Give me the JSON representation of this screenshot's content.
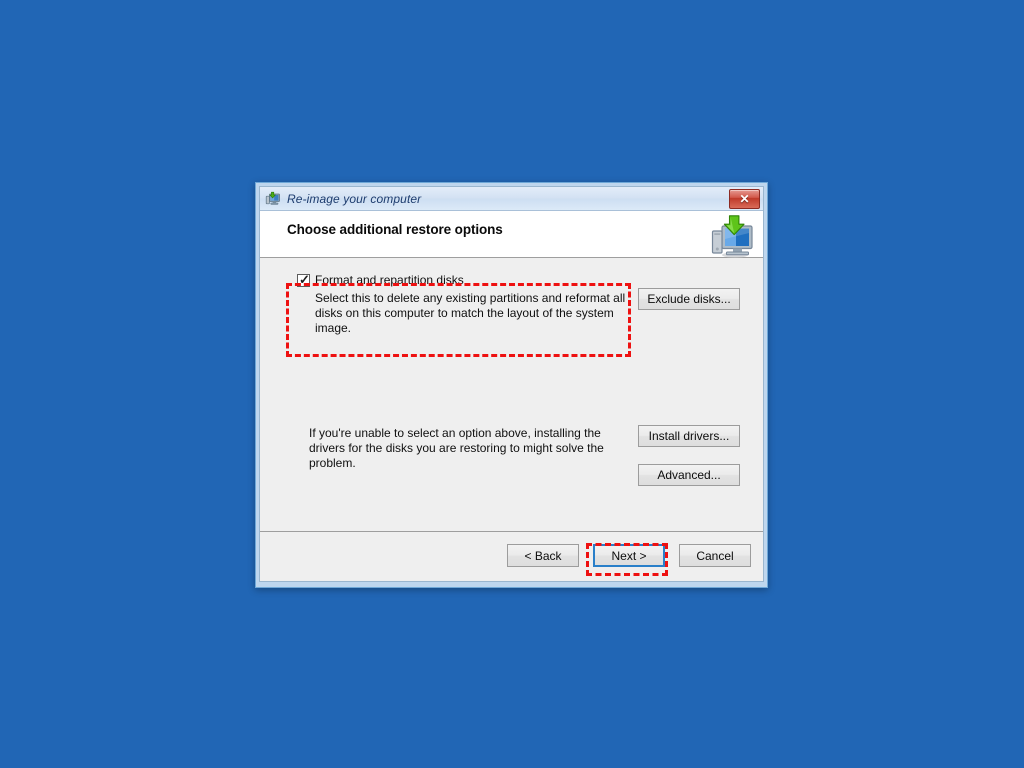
{
  "desktop": {
    "background_color": "#2166b5"
  },
  "window": {
    "titlebar": {
      "icon": "reimage-computer-icon",
      "title": "Re-image your computer",
      "close_label": "✕",
      "close_icon": "close-icon",
      "close_color": "#bf3a2a"
    },
    "header": {
      "title": "Choose additional restore options",
      "icon": "restore-computer-icon"
    },
    "body": {
      "format_option": {
        "checked": true,
        "check_glyph": "✓",
        "label": "Format and repartition disks",
        "description": "Select this to delete any existing partitions and reformat all disks on this computer to match the layout of the system image."
      },
      "exclude_button": "Exclude disks...",
      "driver_hint": "If you're unable to select an option above, installing the drivers for the disks you are restoring to might solve the problem.",
      "install_drivers_button": "Install drivers...",
      "advanced_button": "Advanced..."
    },
    "footer": {
      "back_button": "< Back",
      "next_button": "Next >",
      "cancel_button": "Cancel"
    }
  },
  "annotations": {
    "highlight_color": "#ee1111",
    "focus_color": "#2a7fc9",
    "boxes": [
      {
        "name": "format-option-highlight"
      },
      {
        "name": "next-button-highlight"
      }
    ]
  }
}
